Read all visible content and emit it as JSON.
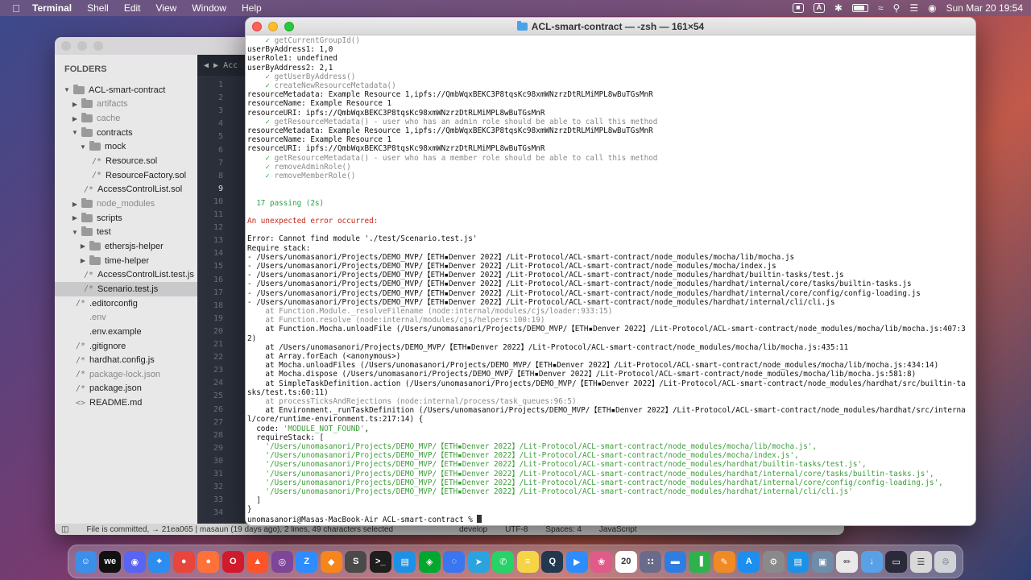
{
  "menubar": {
    "app_name": "Terminal",
    "menus": [
      "Shell",
      "Edit",
      "View",
      "Window",
      "Help"
    ],
    "clock": "Sun Mar 20  19:54"
  },
  "editor": {
    "folders_title": "FOLDERS",
    "tab_label": "Acc",
    "status": {
      "commit": "File is committed, → 21ea065 | masaun (19 days ago), 2 lines, 49 characters selected",
      "branch": "develop",
      "encoding": "UTF-8",
      "spaces": "Spaces: 4",
      "syntax": "JavaScript"
    },
    "tree": [
      {
        "label": "ACL-smart-contract",
        "type": "folder",
        "open": true,
        "depth": 0
      },
      {
        "label": "artifacts",
        "type": "folder",
        "open": false,
        "depth": 1,
        "dim": true
      },
      {
        "label": "cache",
        "type": "folder",
        "open": false,
        "depth": 1,
        "dim": true
      },
      {
        "label": "contracts",
        "type": "folder",
        "open": true,
        "depth": 1
      },
      {
        "label": "mock",
        "type": "folder",
        "open": true,
        "depth": 2
      },
      {
        "label": "Resource.sol",
        "type": "file",
        "glyph": "/*",
        "depth": 3
      },
      {
        "label": "ResourceFactory.sol",
        "type": "file",
        "glyph": "/*",
        "depth": 3
      },
      {
        "label": "AccessControlList.sol",
        "type": "file",
        "glyph": "/*",
        "depth": 2
      },
      {
        "label": "node_modules",
        "type": "folder",
        "open": false,
        "depth": 1,
        "dim": true
      },
      {
        "label": "scripts",
        "type": "folder",
        "open": false,
        "depth": 1
      },
      {
        "label": "test",
        "type": "folder",
        "open": true,
        "depth": 1
      },
      {
        "label": "ethersjs-helper",
        "type": "folder",
        "open": false,
        "depth": 2
      },
      {
        "label": "time-helper",
        "type": "folder",
        "open": false,
        "depth": 2
      },
      {
        "label": "AccessControlList.test.js",
        "type": "file",
        "glyph": "/*",
        "depth": 2
      },
      {
        "label": "Scenario.test.js",
        "type": "file",
        "glyph": "/*",
        "depth": 2,
        "selected": true
      },
      {
        "label": ".editorconfig",
        "type": "file",
        "glyph": "/*",
        "depth": 1
      },
      {
        "label": ".env",
        "type": "file",
        "glyph": "",
        "depth": 1,
        "dim": true
      },
      {
        "label": ".env.example",
        "type": "file",
        "glyph": "",
        "depth": 1
      },
      {
        "label": ".gitignore",
        "type": "file",
        "glyph": "/*",
        "depth": 1
      },
      {
        "label": "hardhat.config.js",
        "type": "file",
        "glyph": "/*",
        "depth": 1
      },
      {
        "label": "package-lock.json",
        "type": "file",
        "glyph": "/*",
        "depth": 1,
        "dim": true
      },
      {
        "label": "package.json",
        "type": "file",
        "glyph": "/*",
        "depth": 1
      },
      {
        "label": "README.md",
        "type": "file",
        "glyph": "<>",
        "depth": 1
      }
    ],
    "line_numbers": [
      "1",
      "2",
      "3",
      "4",
      "5",
      "6",
      "7",
      "8",
      "9",
      "10",
      "11",
      "12",
      "13",
      "14",
      "15",
      "16",
      "17",
      "18",
      "19",
      "20",
      "21",
      "22",
      "23",
      "24",
      "25",
      "26",
      "27",
      "28",
      "29",
      "30",
      "31",
      "32",
      "33",
      "34"
    ],
    "current_line": "9"
  },
  "terminal": {
    "title": "ACL-smart-contract — -zsh — 161×54",
    "lines": [
      {
        "t": "    ✓ getCurrentGroupId()",
        "c": "gray"
      },
      {
        "t": "userByAddress1: 1,0",
        "c": ""
      },
      {
        "t": "userRole1: undefined",
        "c": ""
      },
      {
        "t": "userByAddress2: 2,1",
        "c": ""
      },
      {
        "t": "    ✓ getUserByAddress()",
        "c": "gray"
      },
      {
        "t": "    ✓ createNewResourceMetadata()",
        "c": "gray"
      },
      {
        "t": "resourceMetadata: Example Resource 1,ipfs://QmbWqxBEKC3P8tqsKc98xmWNzrzDtRLMiMPL8wBuTGsMnR",
        "c": ""
      },
      {
        "t": "resourceName: Example Resource 1",
        "c": ""
      },
      {
        "t": "resourceURI: ipfs://QmbWqxBEKC3P8tqsKc98xmWNzrzDtRLMiMPL8wBuTGsMnR",
        "c": ""
      },
      {
        "t": "    ✓ getResourceMetadata() - user who has an admin role should be able to call this method",
        "c": "gray"
      },
      {
        "t": "resourceMetadata: Example Resource 1,ipfs://QmbWqxBEKC3P8tqsKc98xmWNzrzDtRLMiMPL8wBuTGsMnR",
        "c": ""
      },
      {
        "t": "resourceName: Example Resource 1",
        "c": ""
      },
      {
        "t": "resourceURI: ipfs://QmbWqxBEKC3P8tqsKc98xmWNzrzDtRLMiMPL8wBuTGsMnR",
        "c": ""
      },
      {
        "t": "    ✓ getResourceMetadata() - user who has a member role should be able to call this method",
        "c": "gray"
      },
      {
        "t": "    ✓ removeAdminRole()",
        "c": "gray"
      },
      {
        "t": "    ✓ removeMemberRole()",
        "c": "gray"
      },
      {
        "t": "",
        "c": ""
      },
      {
        "t": "",
        "c": ""
      },
      {
        "t": "  17 passing (2s)",
        "c": "green"
      },
      {
        "t": "",
        "c": ""
      },
      {
        "t": "An unexpected error occurred:",
        "c": "red"
      },
      {
        "t": "",
        "c": ""
      },
      {
        "t": "Error: Cannot find module './test/Scenario.test.js'",
        "c": ""
      },
      {
        "t": "Require stack:",
        "c": ""
      },
      {
        "t": "- /Users/unomasanori/Projects/DEMO_MVP/【ETH▪Denver 2022】/Lit-Protocol/ACL-smart-contract/node_modules/mocha/lib/mocha.js",
        "c": ""
      },
      {
        "t": "- /Users/unomasanori/Projects/DEMO_MVP/【ETH▪Denver 2022】/Lit-Protocol/ACL-smart-contract/node_modules/mocha/index.js",
        "c": ""
      },
      {
        "t": "- /Users/unomasanori/Projects/DEMO_MVP/【ETH▪Denver 2022】/Lit-Protocol/ACL-smart-contract/node_modules/hardhat/builtin-tasks/test.js",
        "c": ""
      },
      {
        "t": "- /Users/unomasanori/Projects/DEMO_MVP/【ETH▪Denver 2022】/Lit-Protocol/ACL-smart-contract/node_modules/hardhat/internal/core/tasks/builtin-tasks.js",
        "c": ""
      },
      {
        "t": "- /Users/unomasanori/Projects/DEMO_MVP/【ETH▪Denver 2022】/Lit-Protocol/ACL-smart-contract/node_modules/hardhat/internal/core/config/config-loading.js",
        "c": ""
      },
      {
        "t": "- /Users/unomasanori/Projects/DEMO_MVP/【ETH▪Denver 2022】/Lit-Protocol/ACL-smart-contract/node_modules/hardhat/internal/cli/cli.js",
        "c": ""
      },
      {
        "t": "    at Function.Module._resolveFilename (node:internal/modules/cjs/loader:933:15)",
        "c": "gray"
      },
      {
        "t": "    at Function.resolve (node:internal/modules/cjs/helpers:100:19)",
        "c": "gray"
      },
      {
        "t": "    at Function.Mocha.unloadFile (/Users/unomasanori/Projects/DEMO_MVP/【ETH▪Denver 2022】/Lit-Protocol/ACL-smart-contract/node_modules/mocha/lib/mocha.js:407:3",
        "c": ""
      },
      {
        "t": "2)",
        "c": ""
      },
      {
        "t": "    at /Users/unomasanori/Projects/DEMO_MVP/【ETH▪Denver 2022】/Lit-Protocol/ACL-smart-contract/node_modules/mocha/lib/mocha.js:435:11",
        "c": ""
      },
      {
        "t": "    at Array.forEach (<anonymous>)",
        "c": ""
      },
      {
        "t": "    at Mocha.unloadFiles (/Users/unomasanori/Projects/DEMO_MVP/【ETH▪Denver 2022】/Lit-Protocol/ACL-smart-contract/node_modules/mocha/lib/mocha.js:434:14)",
        "c": ""
      },
      {
        "t": "    at Mocha.dispose (/Users/unomasanori/Projects/DEMO_MVP/【ETH▪Denver 2022】/Lit-Protocol/ACL-smart-contract/node_modules/mocha/lib/mocha.js:581:8)",
        "c": ""
      },
      {
        "t": "    at SimpleTaskDefinition.action (/Users/unomasanori/Projects/DEMO_MVP/【ETH▪Denver 2022】/Lit-Protocol/ACL-smart-contract/node_modules/hardhat/src/builtin-ta",
        "c": ""
      },
      {
        "t": "sks/test.ts:60:11)",
        "c": ""
      },
      {
        "t": "    at processTicksAndRejections (node:internal/process/task_queues:96:5)",
        "c": "gray"
      },
      {
        "t": "    at Environment._runTaskDefinition (/Users/unomasanori/Projects/DEMO_MVP/【ETH▪Denver 2022】/Lit-Protocol/ACL-smart-contract/node_modules/hardhat/src/interna",
        "c": ""
      },
      {
        "t": "l/core/runtime-environment.ts:217:14) {",
        "c": ""
      },
      {
        "t": "  code: 'MODULE_NOT_FOUND',",
        "c": "code"
      },
      {
        "t": "  requireStack: [",
        "c": ""
      },
      {
        "t": "    '/Users/unomasanori/Projects/DEMO_MVP/【ETH▪Denver 2022】/Lit-Protocol/ACL-smart-contract/node_modules/mocha/lib/mocha.js',",
        "c": "str"
      },
      {
        "t": "    '/Users/unomasanori/Projects/DEMO_MVP/【ETH▪Denver 2022】/Lit-Protocol/ACL-smart-contract/node_modules/mocha/index.js',",
        "c": "str"
      },
      {
        "t": "    '/Users/unomasanori/Projects/DEMO_MVP/【ETH▪Denver 2022】/Lit-Protocol/ACL-smart-contract/node_modules/hardhat/builtin-tasks/test.js',",
        "c": "str"
      },
      {
        "t": "    '/Users/unomasanori/Projects/DEMO_MVP/【ETH▪Denver 2022】/Lit-Protocol/ACL-smart-contract/node_modules/hardhat/internal/core/tasks/builtin-tasks.js',",
        "c": "str"
      },
      {
        "t": "    '/Users/unomasanori/Projects/DEMO_MVP/【ETH▪Denver 2022】/Lit-Protocol/ACL-smart-contract/node_modules/hardhat/internal/core/config/config-loading.js',",
        "c": "str"
      },
      {
        "t": "    '/Users/unomasanori/Projects/DEMO_MVP/【ETH▪Denver 2022】/Lit-Protocol/ACL-smart-contract/node_modules/hardhat/internal/cli/cli.js'",
        "c": "str"
      },
      {
        "t": "  ]",
        "c": ""
      },
      {
        "t": "}",
        "c": ""
      },
      {
        "t": "unomasanori@Masas-MacBook-Air ACL-smart-contract % ",
        "c": "prompt"
      }
    ]
  },
  "dock": {
    "apps": [
      {
        "name": "finder",
        "color": "#3b8fe8",
        "glyph": "☺"
      },
      {
        "name": "we",
        "color": "#111111",
        "glyph": "we"
      },
      {
        "name": "discord",
        "color": "#5865f2",
        "glyph": "◉"
      },
      {
        "name": "safari",
        "color": "#2d8cf0",
        "glyph": "⌖"
      },
      {
        "name": "chrome",
        "color": "#e8453c",
        "glyph": "●"
      },
      {
        "name": "firefox",
        "color": "#ff7139",
        "glyph": "●"
      },
      {
        "name": "opera",
        "color": "#d21a2d",
        "glyph": "O"
      },
      {
        "name": "brave",
        "color": "#fb542b",
        "glyph": "▲"
      },
      {
        "name": "tor",
        "color": "#7d4698",
        "glyph": "◎"
      },
      {
        "name": "zoom-z",
        "color": "#2d8cff",
        "glyph": "Z"
      },
      {
        "name": "metamask",
        "color": "#f6851b",
        "glyph": "◆"
      },
      {
        "name": "sublime",
        "color": "#4a4a4a",
        "glyph": "S"
      },
      {
        "name": "terminal",
        "color": "#1e1e1e",
        "glyph": ">_"
      },
      {
        "name": "docker-whale",
        "color": "#1d91e6",
        "glyph": "▤"
      },
      {
        "name": "evernote",
        "color": "#00a82d",
        "glyph": "◈"
      },
      {
        "name": "signal",
        "color": "#3a76f0",
        "glyph": "◌"
      },
      {
        "name": "telegram",
        "color": "#2aa3df",
        "glyph": "➤"
      },
      {
        "name": "whatsapp",
        "color": "#25d366",
        "glyph": "✆"
      },
      {
        "name": "notes",
        "color": "#f5d547",
        "glyph": "≡"
      },
      {
        "name": "quicktime",
        "color": "#22384f",
        "glyph": "Q"
      },
      {
        "name": "zoom",
        "color": "#2d8cff",
        "glyph": "▶"
      },
      {
        "name": "photos",
        "color": "#e05a8a",
        "glyph": "❀"
      },
      {
        "name": "calendar",
        "color": "#ffffff",
        "glyph": "20"
      },
      {
        "name": "launchpad",
        "color": "#6a6a8a",
        "glyph": "∷"
      },
      {
        "name": "keynote",
        "color": "#2f7de1",
        "glyph": "▬"
      },
      {
        "name": "numbers",
        "color": "#2fb14b",
        "glyph": "▐"
      },
      {
        "name": "pages",
        "color": "#f08a24",
        "glyph": "✎"
      },
      {
        "name": "app-store",
        "color": "#1c8ef0",
        "glyph": "A"
      },
      {
        "name": "system-preferences",
        "color": "#8a8a8a",
        "glyph": "⚙"
      },
      {
        "name": "docker",
        "color": "#1d91e6",
        "glyph": "▤"
      },
      {
        "name": "finder-window",
        "color": "#6f8ca8",
        "glyph": "▣"
      },
      {
        "name": "textedit",
        "color": "#e9e9e9",
        "glyph": "✏"
      },
      {
        "name": "downloads",
        "color": "#5aa0e6",
        "glyph": "↓"
      },
      {
        "name": "screen",
        "color": "#2a2a3a",
        "glyph": "▭"
      },
      {
        "name": "document",
        "color": "#d8d8d8",
        "glyph": "☰"
      },
      {
        "name": "trash",
        "color": "#cfd3d8",
        "glyph": "♲"
      }
    ]
  }
}
